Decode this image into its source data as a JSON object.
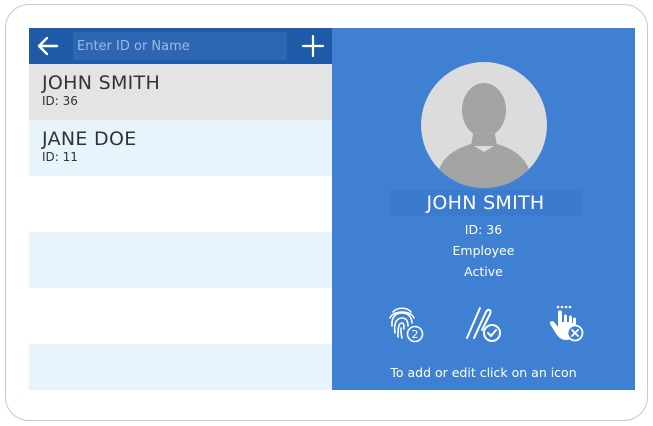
{
  "search": {
    "placeholder": "Enter ID or Name",
    "value": ""
  },
  "list": [
    {
      "name": "JOHN SMITH",
      "id": "ID: 36",
      "selected": true
    },
    {
      "name": "JANE DOE",
      "id": "ID: 11",
      "selected": false
    }
  ],
  "detail": {
    "name": "JOHN SMITH",
    "id": "ID: 36",
    "role": "Employee",
    "status": "Active",
    "hint": "To add or edit click on an icon",
    "fingerprint_count": "2"
  },
  "icons": {
    "back": "arrow-left-icon",
    "add": "plus-icon",
    "avatar": "user-avatar",
    "fingerprint": "fingerprint-icon",
    "card": "card-icon",
    "pin": "pin-icon"
  },
  "colors": {
    "topbar": "#1f5aa8",
    "detail_panel": "#3f80d3",
    "selected_row": "#e4e4e4",
    "tinted_row": "#e8f4fc"
  }
}
